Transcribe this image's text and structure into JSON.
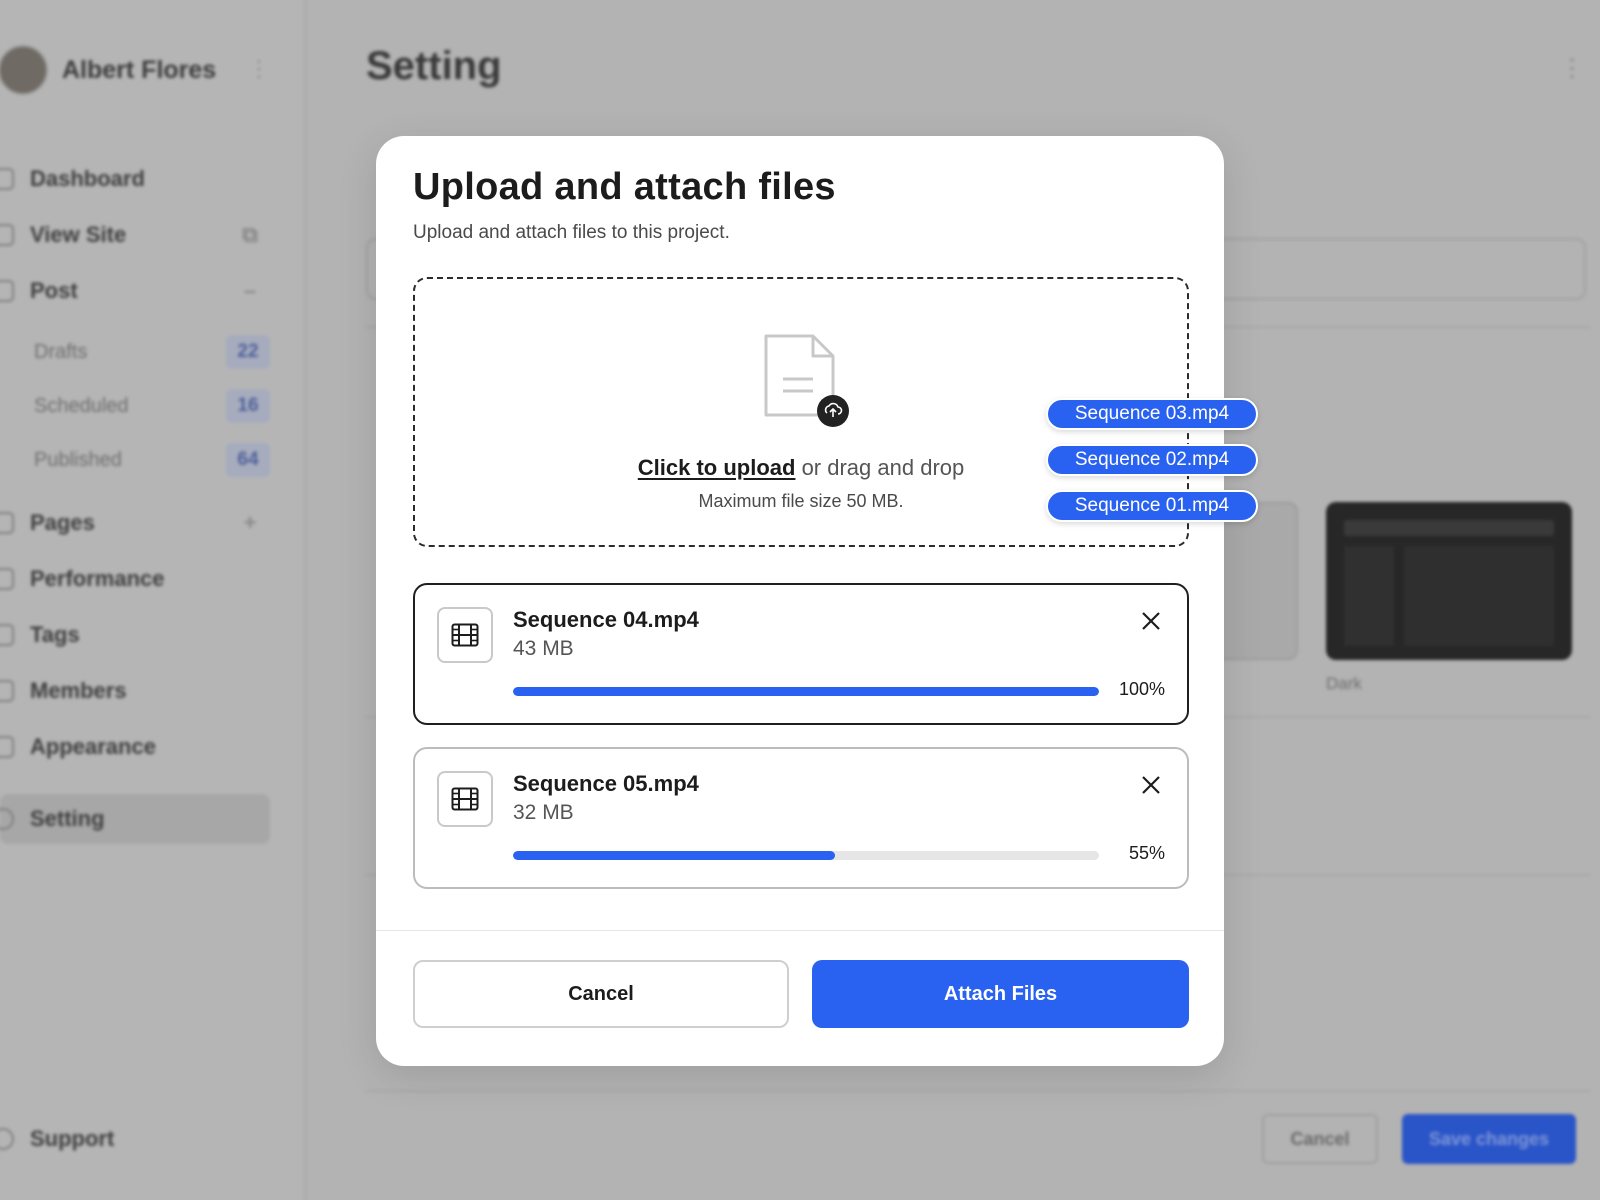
{
  "sidebar": {
    "user_name": "Albert Flores",
    "nav": [
      {
        "label": "Dashboard",
        "icon": "home-icon"
      },
      {
        "label": "View Site",
        "icon": "globe-icon"
      },
      {
        "label": "Post",
        "icon": "plus-square-icon"
      },
      {
        "label": "Pages",
        "icon": "pages-icon"
      },
      {
        "label": "Performance",
        "icon": "chart-icon"
      },
      {
        "label": "Tags",
        "icon": "tag-icon"
      },
      {
        "label": "Members",
        "icon": "members-icon"
      },
      {
        "label": "Appearance",
        "icon": "palette-icon"
      },
      {
        "label": "Setting",
        "icon": "gear-icon"
      }
    ],
    "post_subitems": [
      {
        "label": "Drafts",
        "count": "22"
      },
      {
        "label": "Scheduled",
        "count": "16"
      },
      {
        "label": "Published",
        "count": "64"
      }
    ],
    "support_label": "Support"
  },
  "main": {
    "title": "Setting",
    "theme_dark_label": "Dark",
    "cancel_label": "Cancel",
    "save_label": "Save changes"
  },
  "modal": {
    "title": "Upload and attach files",
    "subtitle": "Upload and attach files to this project.",
    "dropzone": {
      "link_text": "Click to upload",
      "rest_text": " or drag and drop",
      "limit_text": "Maximum file size 50 MB."
    },
    "dragging_files": [
      "Sequence 03.mp4",
      "Sequence 02.mp4",
      "Sequence 01.mp4"
    ],
    "files": [
      {
        "name": "Sequence 04.mp4",
        "size": "43 MB",
        "progress": 100,
        "progress_label": "100%"
      },
      {
        "name": "Sequence 05.mp4",
        "size": "32 MB",
        "progress": 55,
        "progress_label": "55%"
      }
    ],
    "cancel_label": "Cancel",
    "attach_label": "Attach Files"
  },
  "colors": {
    "accent": "#2962f0",
    "overlay": "#b3b3b3"
  }
}
